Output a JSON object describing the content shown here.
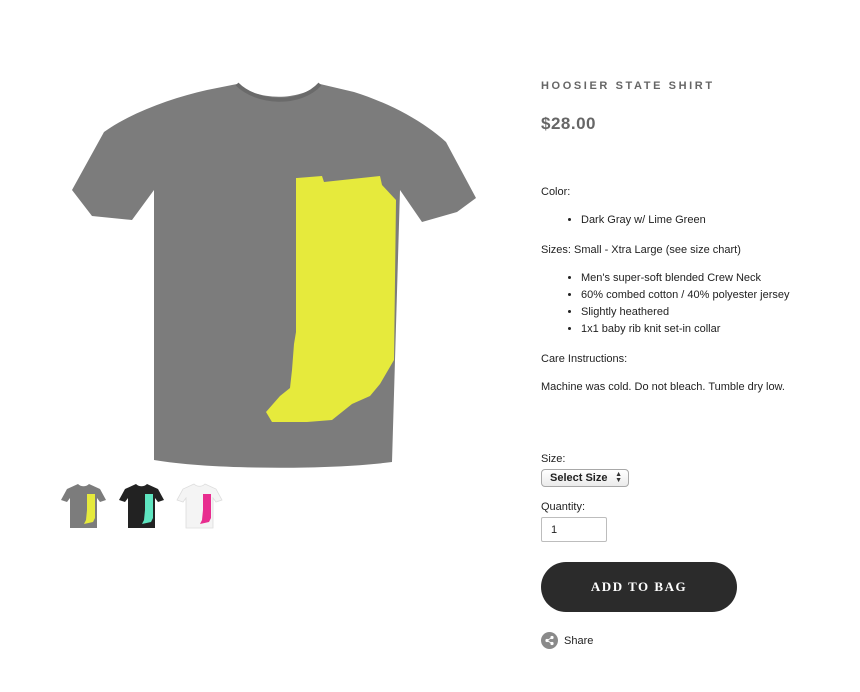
{
  "product": {
    "title": "HOOSIER STATE SHIRT",
    "price": "$28.00"
  },
  "description": {
    "color_label": "Color:",
    "colors": [
      "Dark Gray w/ Lime Green"
    ],
    "sizes_label": "Sizes: Small - Xtra Large (see size chart)",
    "features": [
      "Men's super-soft blended Crew Neck",
      "60% combed cotton / 40% polyester jersey",
      "Slightly heathered",
      "1x1 baby rib knit set-in collar"
    ],
    "care_label": "Care Instructions:",
    "care_text": "Machine was cold.  Do not bleach.  Tumble dry low."
  },
  "form": {
    "size_label": "Size:",
    "size_selected": "Select Size",
    "quantity_label": "Quantity:",
    "quantity_value": "1",
    "add_to_bag_label": "ADD TO BAG",
    "share_label": "Share"
  },
  "images": {
    "main": {
      "shirt_color": "#7c7c7c",
      "print_color": "#e6ea3c"
    },
    "thumbnails": [
      {
        "shirt_color": "#7c7c7c",
        "print_color": "#e6ea3c"
      },
      {
        "shirt_color": "#222222",
        "print_color": "#5ee5c0"
      },
      {
        "shirt_color": "#f4f4f4",
        "print_color": "#e82d8f"
      }
    ]
  },
  "colors": {
    "button_bg": "#2b2b2b",
    "title_text": "#666666"
  },
  "icons": {
    "share": "share-icon",
    "select_arrows": "updown-arrows-icon"
  }
}
